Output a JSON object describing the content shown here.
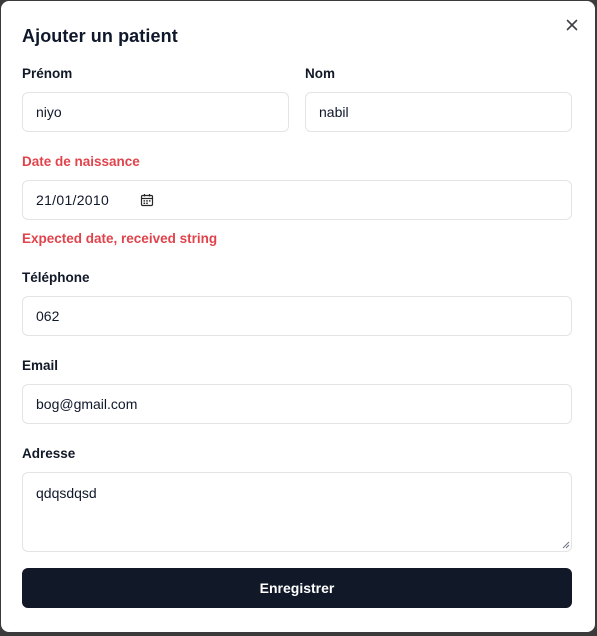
{
  "dialog": {
    "title": "Ajouter un patient",
    "close_icon": "close-icon"
  },
  "form": {
    "first_name": {
      "label": "Prénom",
      "value": "niyo"
    },
    "last_name": {
      "label": "Nom",
      "value": "nabil"
    },
    "birth_date": {
      "label": "Date de naissance",
      "value": "21/01/2010",
      "icon": "calendar-icon",
      "error": "Expected date, received string"
    },
    "phone": {
      "label": "Téléphone",
      "value": "062"
    },
    "email": {
      "label": "Email",
      "value": "bog@gmail.com"
    },
    "address": {
      "label": "Adresse",
      "value": "qdqsdqsd"
    },
    "submit_label": "Enregistrer"
  },
  "colors": {
    "primary": "#111827",
    "error": "#e0434b",
    "border": "#e4e4e7"
  }
}
